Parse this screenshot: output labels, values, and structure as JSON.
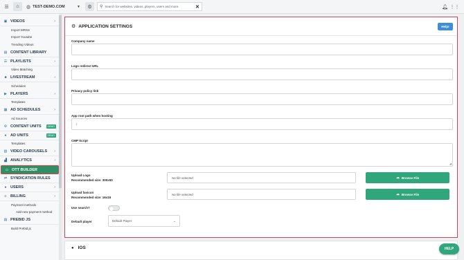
{
  "topbar": {
    "site_name": "TEST-DEMO.COM",
    "search_placeholder": "Search for websites, videos, players, users and more.",
    "icons": [
      "menu-icon",
      "home-icon",
      "globe-icon",
      "gear-icon",
      "search-icon",
      "close-icon",
      "bell-icon",
      "apps-grid-icon"
    ]
  },
  "sidebar": {
    "videos": "VIDEOS",
    "import_mrss": "Import MRSS",
    "import_youtube": "Import Youtube",
    "trending_videos": "Trending Videos",
    "content_library": "CONTENT LIBRARY",
    "playlists": "PLAYLISTS",
    "video_matching": "Video Matching",
    "livestream": "LIVESTREAM",
    "schedules": "Schedules",
    "players": "PLAYERS",
    "templates_players": "Templates",
    "ad_schedules": "AD SCHEDULES",
    "ad_sources": "Ad Sources",
    "content_units": "CONTENT UNITS",
    "demo_badge": "DEMO",
    "ad_units": "AD UNITS",
    "templates_ad_units": "Templates",
    "video_carousels": "VIDEO CAROUSELS",
    "analytics": "ANALYTICS",
    "ott_builder": "OTT BUILDER",
    "syndication_rules": "SYNDICATION RULES",
    "users": "USERS",
    "billing": "BILLING",
    "payment_methods": "Payment methods",
    "add_payment_method": "Add new payment method",
    "prebid_js": "PREBID JS",
    "build_prebid": "Build Prebid.js"
  },
  "main": {
    "title": "APPLICATION SETTINGS",
    "help_button": "Help!",
    "fields": {
      "company_name": {
        "label": "Company name",
        "value": ""
      },
      "logo_redirect_url": {
        "label": "Logo redirect URL",
        "value": ""
      },
      "privacy_policy_link": {
        "label": "Privacy policy link",
        "value": ""
      },
      "app_root_path": {
        "label": "App root path when hosting",
        "value": "/"
      },
      "cmp_script": {
        "label": "CMP Script",
        "value": ""
      }
    },
    "upload_logo": {
      "label": "Upload Logo",
      "recommended": "Recommended size: 300x50",
      "file_status": "No file selected",
      "button": "Browse File"
    },
    "upload_favicon": {
      "label": "Upload favicon",
      "recommended": "Recommended size: 16x16",
      "file_status": "No file selected",
      "button": "Browse File"
    },
    "use_search": {
      "label": "Use search?",
      "enabled": false
    },
    "default_player": {
      "label": "Default player",
      "selected": "Default Player"
    }
  },
  "ios_section": {
    "title": "IOS"
  },
  "help_float": "HELP",
  "colors": {
    "accent_green": "#2fa67c",
    "active_nav": "#2f8f62",
    "help_blue": "#3d8fd1",
    "highlight_border": "#c94655"
  }
}
